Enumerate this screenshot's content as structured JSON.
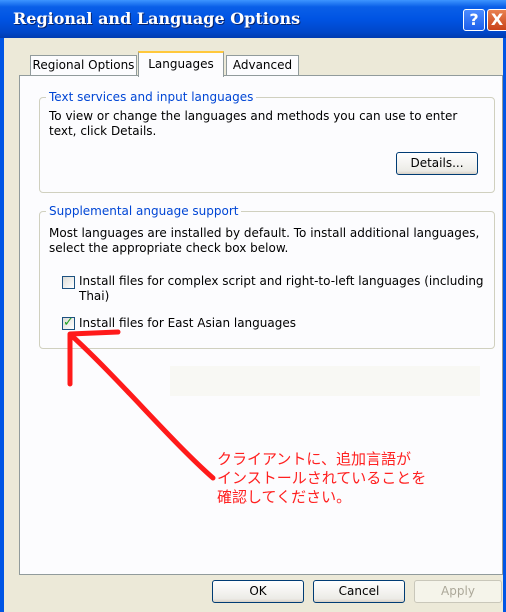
{
  "window": {
    "title": "Regional and Language Options",
    "help_glyph": "?",
    "close_glyph": "X"
  },
  "tabs": [
    {
      "label": "Regional Options",
      "active": false
    },
    {
      "label": "Languages",
      "active": true
    },
    {
      "label": "Advanced",
      "active": false
    }
  ],
  "text_services": {
    "legend": "Text services and input languages",
    "description_line1": "To view or change the languages and methods you can use to enter",
    "description_line2": "text, click Details.",
    "details_button": "Details..."
  },
  "supplemental": {
    "legend": "Supplemental anguage support",
    "description_line1": "Most languages are installed by default. To install additional languages,",
    "description_line2": "select the appropriate check box below.",
    "checkbox_complex_line1": "Install files for complex script and right-to-left languages (including",
    "checkbox_complex_line2": "Thai)",
    "checkbox_complex_checked": false,
    "checkbox_east_asian": "Install files for East Asian languages",
    "checkbox_east_asian_checked": true
  },
  "annotation": {
    "line1": "クライアントに、追加言語が",
    "line2": "インストールされていることを",
    "line3": "確認してください。",
    "color": "#ff2020"
  },
  "buttons": {
    "ok": "OK",
    "cancel": "Cancel",
    "apply": "Apply"
  }
}
